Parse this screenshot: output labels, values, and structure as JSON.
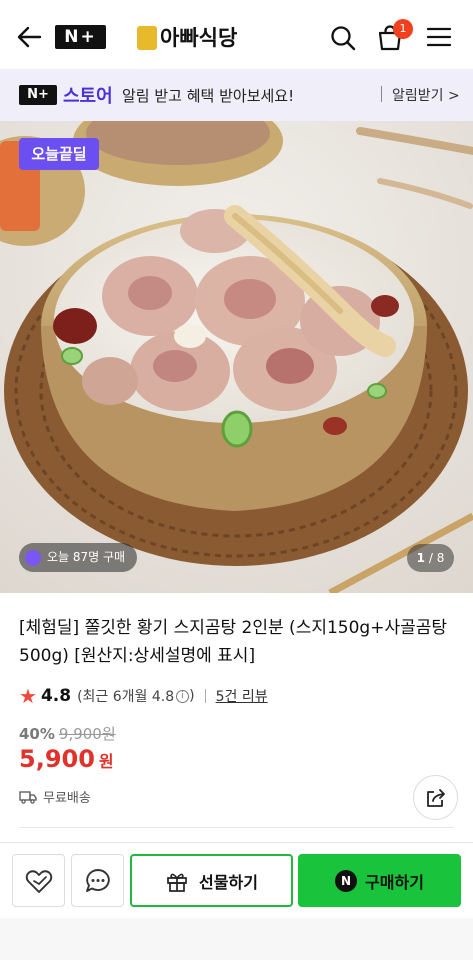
{
  "header": {
    "brand_badge": "N+",
    "shop_name": "아빠식당",
    "cart_count": "1"
  },
  "banner": {
    "badge": "N+",
    "store_label": "스토어",
    "message": "알림 받고 혜택 받아보세요!",
    "link": "알림받기 >"
  },
  "hero": {
    "deal_badge": "오늘끝딜",
    "buyers_text": "오늘 87명 구매",
    "page_current": "1",
    "page_total": "/ 8"
  },
  "product": {
    "title": "[체험딜] 쫄깃한 황기 스지곰탕 2인분 (스지150g+사골곰탕500g) [원산지:상세설명에 표시]",
    "rating": "4.8",
    "rating_info": "(최근 6개월 4.8",
    "rating_info_close": ")",
    "reviews": "5건 리뷰",
    "discount": "40%",
    "original_price": "9,900원",
    "price": "5,900",
    "currency": "원",
    "shipping": "무료배송"
  },
  "actions": {
    "gift": "선물하기",
    "buy": "구매하기",
    "npay_symbol": "N"
  },
  "colors": {
    "accent_purple": "#6c4ff0",
    "price_red": "#e0312b",
    "buy_green": "#19c33c"
  }
}
